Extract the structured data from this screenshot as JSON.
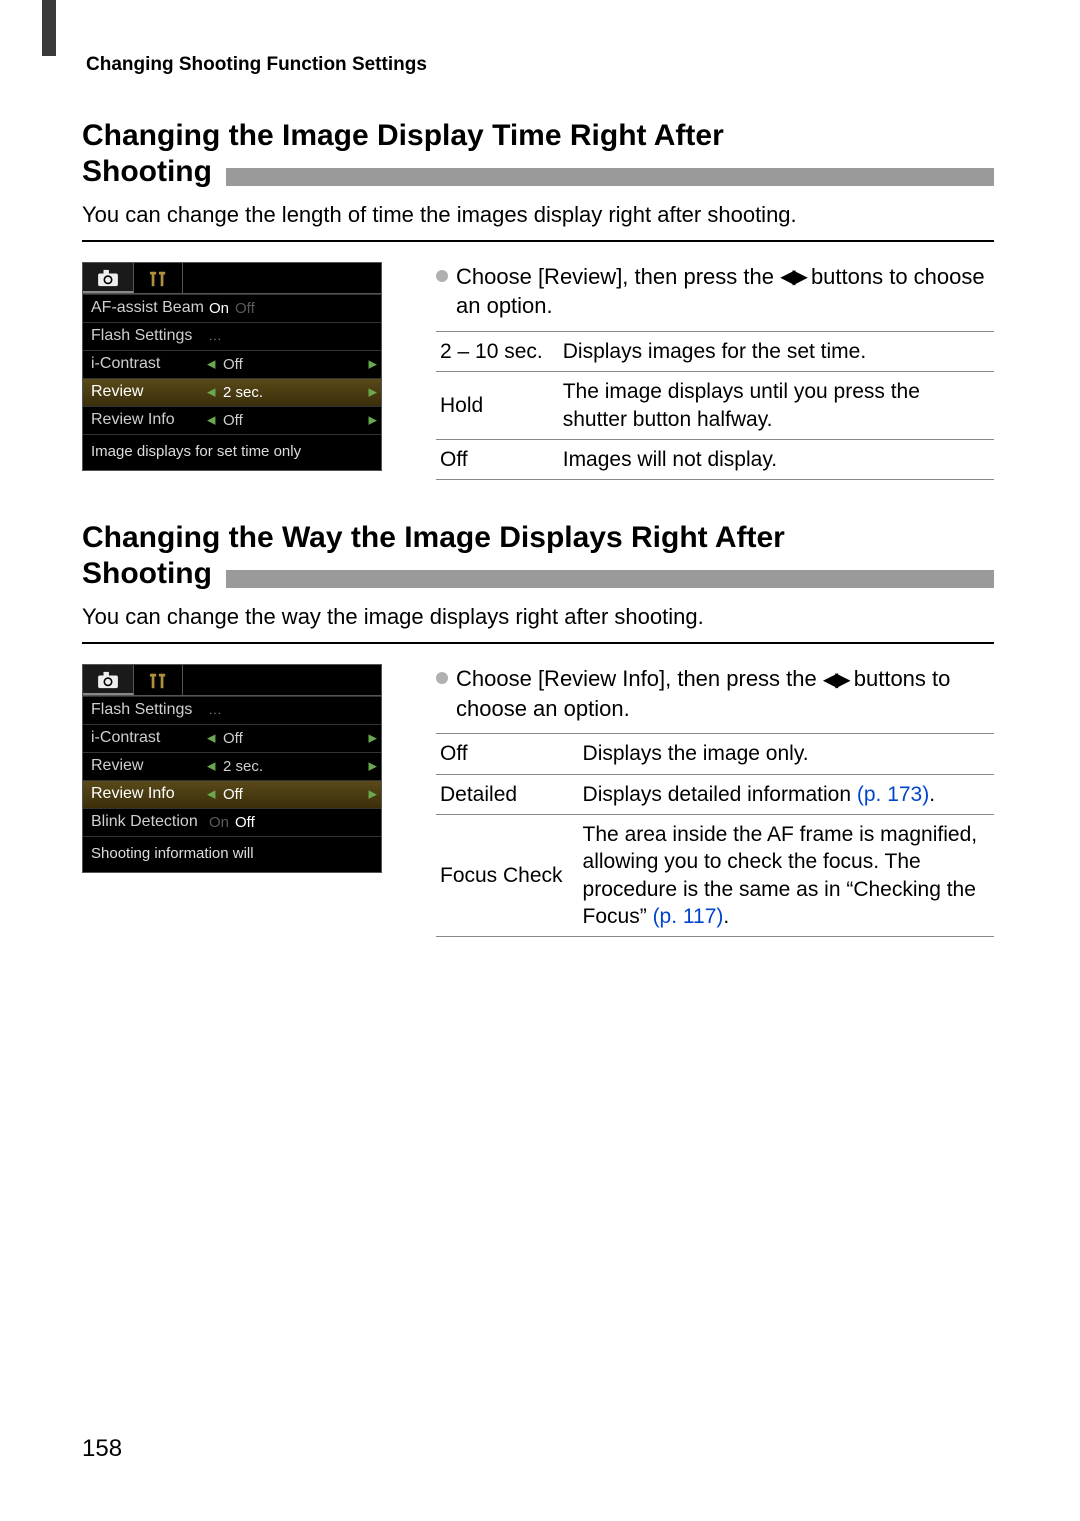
{
  "header": "Changing Shooting Function Settings",
  "page_number": "158",
  "section1": {
    "title": "Changing the Image Display Time Right After Shooting",
    "intro": "You can change the length of time the images display right after shooting.",
    "instruction_pre": "Choose [Review], then press the ",
    "instruction_post": " buttons to choose an option.",
    "table": [
      {
        "opt": "2 – 10 sec.",
        "desc": "Displays images for the set time."
      },
      {
        "opt": "Hold",
        "desc": "The image displays until you press the shutter button halfway."
      },
      {
        "opt": "Off",
        "desc": "Images will not display."
      }
    ],
    "lcd": {
      "rows": [
        {
          "label": "AF-assist Beam",
          "on": "On",
          "off": "Off",
          "type": "onoff"
        },
        {
          "label": "Flash Settings",
          "type": "dots"
        },
        {
          "label": "i-Contrast",
          "val": "Off",
          "type": "arrow"
        },
        {
          "label": "Review",
          "val": "2 sec.",
          "type": "arrow",
          "selected": true
        },
        {
          "label": "Review Info",
          "val": "Off",
          "type": "arrow"
        }
      ],
      "footer": "Image displays for set time only"
    }
  },
  "section2": {
    "title": "Changing the Way the Image Displays Right After Shooting",
    "intro": "You can change the way the image displays right after shooting.",
    "instruction_pre": "Choose [Review Info], then press the ",
    "instruction_post": " buttons to choose an option.",
    "table": [
      {
        "opt": "Off",
        "desc": "Displays the image only."
      },
      {
        "opt": "Detailed",
        "desc_pre": "Displays detailed information ",
        "link": "(p. 173)",
        "desc_post": "."
      },
      {
        "opt": "Focus Check",
        "desc_pre": "The area inside the AF frame is magnified, allowing you to check the focus. The procedure is the same as in “Checking the Focus” ",
        "link": "(p. 117)",
        "desc_post": "."
      }
    ],
    "lcd": {
      "rows": [
        {
          "label": "Flash Settings",
          "type": "dots"
        },
        {
          "label": "i-Contrast",
          "val": "Off",
          "type": "arrow"
        },
        {
          "label": "Review",
          "val": "2 sec.",
          "type": "arrow"
        },
        {
          "label": "Review Info",
          "val": "Off",
          "type": "arrow",
          "selected": true
        },
        {
          "label": "Blink Detection",
          "on": "On",
          "off": "Off",
          "type": "onoff_rev"
        }
      ],
      "footer": "Shooting information will"
    }
  }
}
